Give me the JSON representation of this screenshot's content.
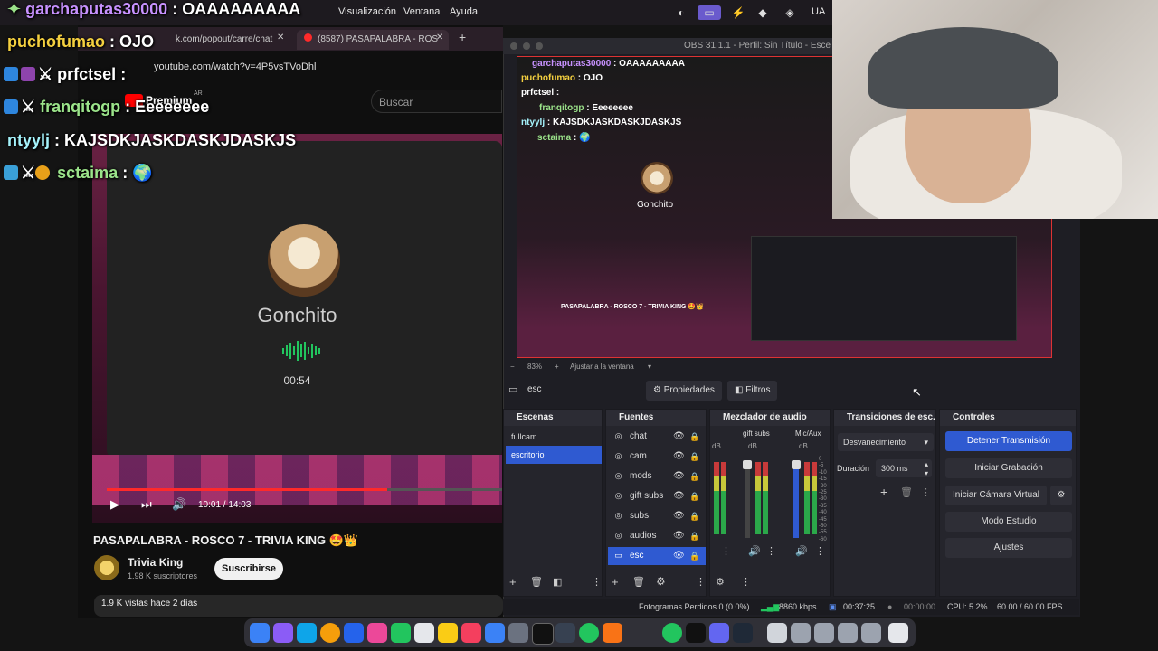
{
  "menubar": {
    "items": [
      "Visualización",
      "Ventana",
      "Ayuda"
    ],
    "right": "UA"
  },
  "browser": {
    "tabs": [
      "k.com/popout/carre/chat",
      "(8587) PASAPALABRA - ROS"
    ],
    "url": "youtube.com/watch?v=4P5vsTVoDhl",
    "brand": "Premium",
    "brand_country": "AR",
    "search_placeholder": "Buscar"
  },
  "video": {
    "title_in_video": "Gonchito",
    "timer": "00:54",
    "time": "10:01 / 14:03",
    "progress": 0.71
  },
  "watch": {
    "title": "PASAPALABRA - ROSCO 7 - TRIVIA KING 🤩👑",
    "channel": "Trivia King",
    "subscribers": "1.98 K suscriptores",
    "subscribe": "Suscribirse",
    "views": "1.9 K vistas  hace 2 días"
  },
  "chat": [
    {
      "user": "garchaputas30000",
      "msg": "OAAAAAAAAA",
      "color": "#c892ff"
    },
    {
      "user": "puchofumao",
      "msg": "OJO",
      "color": "#f4d03f"
    },
    {
      "user": "prfctsel",
      "msg": "",
      "color": "#ffffff"
    },
    {
      "user": "franqitogp",
      "msg": "Eeeeeeee",
      "color": "#9be38a"
    },
    {
      "user": "ntyylj",
      "msg": "KAJSDKJASKDASKJDASKJS",
      "color": "#a5f3fc"
    },
    {
      "user": "sctaima",
      "msg": "🌍",
      "color": "#9be38a"
    }
  ],
  "obs": {
    "title": "OBS 31.1.1 - Perfil: Sin Título - Esce",
    "zoom": "83%",
    "fit": "Ajustar a la ventana",
    "current_source": "esc",
    "properties": "Propiedades",
    "filters": "Filtros",
    "scenes_header": "Escenas",
    "scenes": [
      "fullcam",
      "escritorio"
    ],
    "sources_header": "Fuentes",
    "sources": [
      "chat",
      "cam",
      "mods",
      "gift subs",
      "subs",
      "audios",
      "esc"
    ],
    "mixer_header": "Mezclador de audio",
    "mixer_channels": [
      "gift subs",
      "Mic/Aux"
    ],
    "mixer_db_label": "dB",
    "mixer_scale": [
      "0",
      "-5",
      "-10",
      "-15",
      "-20",
      "-25",
      "-30",
      "-35",
      "-40",
      "-45",
      "-50",
      "-55",
      "-60"
    ],
    "transitions_header": "Transiciones de esc...",
    "transition": "Desvanecimiento",
    "duration_label": "Duración",
    "duration_value": "300 ms",
    "controls_header": "Controles",
    "controls": [
      "Detener Transmisión",
      "Iniciar Grabación",
      "Iniciar Cámara Virtual",
      "Modo Estudio",
      "Ajustes"
    ],
    "status": {
      "dropped": "Fotogramas Perdidos 0 (0.0%)",
      "bitrate": "8860 kbps",
      "stream_time": "00:37:25",
      "rec_time": "00:00:00",
      "cpu": "CPU: 5.2%",
      "fps": "60.00 / 60.00 FPS"
    }
  },
  "colors": {
    "accent": "#2f5ad1",
    "preview_border": "#dd3333",
    "youtube_red": "#ff2a2a",
    "audio_green": "#22c55e"
  }
}
